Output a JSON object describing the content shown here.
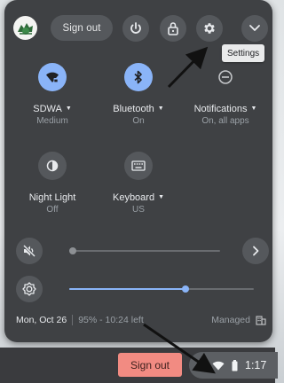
{
  "panel": {
    "signout_label": "Sign out",
    "tooltip": "Settings"
  },
  "tiles": [
    {
      "label": "SDWA",
      "sub": "Medium",
      "has_dropdown": true
    },
    {
      "label": "Bluetooth",
      "sub": "On",
      "has_dropdown": true
    },
    {
      "label": "Notifications",
      "sub": "On, all apps",
      "has_dropdown": true
    },
    {
      "label": "Night Light",
      "sub": "Off",
      "has_dropdown": false
    },
    {
      "label": "Keyboard",
      "sub": "US",
      "has_dropdown": true
    }
  ],
  "volume": {
    "level": 0.0,
    "muted": true
  },
  "brightness": {
    "level": 0.63
  },
  "bottom": {
    "date": "Mon, Oct 26",
    "battery": "95% - 10:24 left",
    "managed": "Managed"
  },
  "shelf": {
    "signout_label": "Sign out",
    "time": "1:17"
  },
  "colors": {
    "accent": "#8ab4f8",
    "panel_bg": "#3f4144",
    "shelf_signout": "#f28b82"
  }
}
